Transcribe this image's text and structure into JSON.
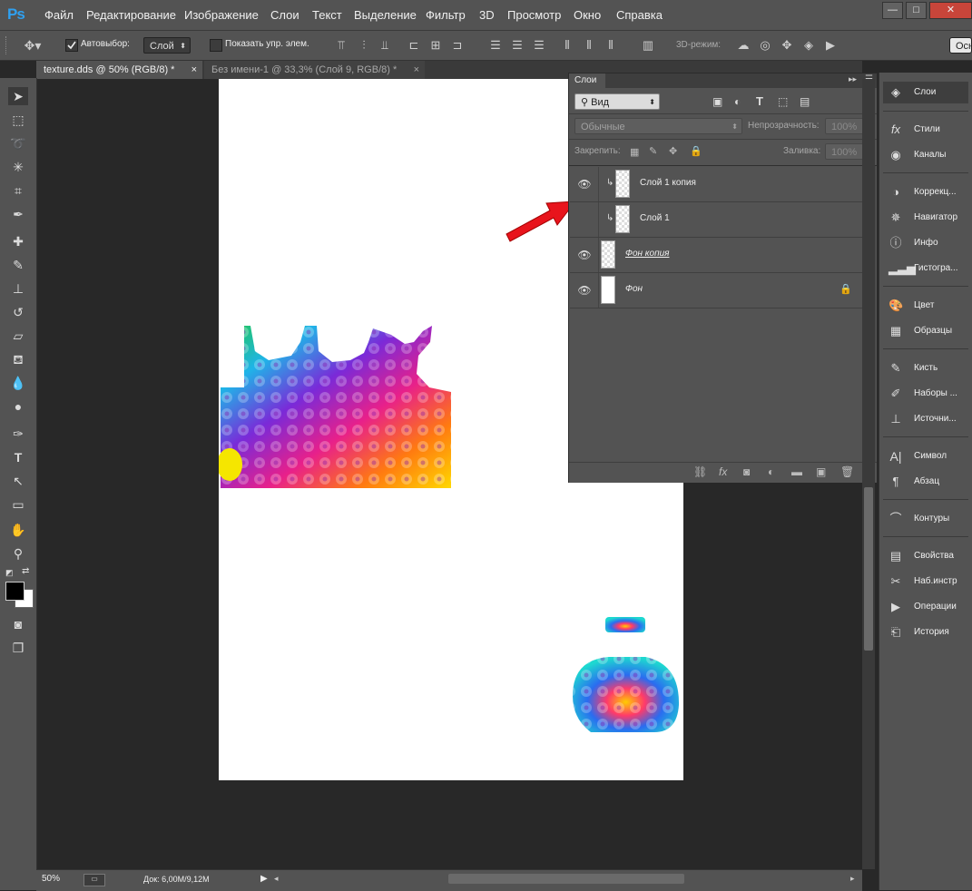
{
  "app": {
    "logo": "Ps"
  },
  "menu": [
    "Файл",
    "Редактирование",
    "Изображение",
    "Слои",
    "Текст",
    "Выделение",
    "Фильтр",
    "3D",
    "Просмотр",
    "Окно",
    "Справка"
  ],
  "window_controls": {
    "minimize": "—",
    "maximize": "□",
    "close": "✕"
  },
  "options_bar": {
    "autoselect_label": "Автовыбор:",
    "autoselect_checked": true,
    "autoselect_target": "Слой",
    "show_transform_label": "Показать упр. элем.",
    "mode3d_label": "3D-режим:",
    "workspace_button": "Осн"
  },
  "tabs": [
    {
      "label": "texture.dds @ 50% (RGB/8) *",
      "close": "×",
      "active": true
    },
    {
      "label": "Без имени-1 @ 33,3% (Слой 9, RGB/8) *",
      "close": "×",
      "active": false
    }
  ],
  "layers_panel": {
    "title": "Слои",
    "filter_kind": "Вид",
    "blend_mode": "Обычные",
    "opacity_label": "Непрозрачность:",
    "opacity_value": "100%",
    "lock_label": "Закрепить:",
    "fill_label": "Заливка:",
    "fill_value": "100%",
    "layers": [
      {
        "name": "Слой 1 копия",
        "clipped": true,
        "visible": true,
        "locked": false
      },
      {
        "name": "Слой 1",
        "clipped": true,
        "visible": true,
        "locked": false
      },
      {
        "name": "Фон копия",
        "clipped": false,
        "visible": true,
        "locked": false
      },
      {
        "name": "Фон",
        "clipped": false,
        "visible": true,
        "locked": true
      }
    ]
  },
  "dock": [
    {
      "label": "Слои",
      "icon": "layers-icon",
      "active": true
    },
    {
      "label": "Стили",
      "icon": "styles-icon"
    },
    {
      "label": "Каналы",
      "icon": "channels-icon"
    },
    {
      "label": "Коррекц...",
      "icon": "adjustments-icon"
    },
    {
      "label": "Навигатор",
      "icon": "navigator-icon"
    },
    {
      "label": "Инфо",
      "icon": "info-icon"
    },
    {
      "label": "Гистогра...",
      "icon": "histogram-icon"
    },
    {
      "label": "Цвет",
      "icon": "color-icon"
    },
    {
      "label": "Образцы",
      "icon": "swatches-icon"
    },
    {
      "label": "Кисть",
      "icon": "brush-icon"
    },
    {
      "label": "Наборы ...",
      "icon": "brush-presets-icon"
    },
    {
      "label": "Источни...",
      "icon": "clone-source-icon"
    },
    {
      "label": "Символ",
      "icon": "character-icon"
    },
    {
      "label": "Абзац",
      "icon": "paragraph-icon"
    },
    {
      "label": "Контуры",
      "icon": "paths-icon"
    },
    {
      "label": "Свойства",
      "icon": "properties-icon"
    },
    {
      "label": "Наб.инстр",
      "icon": "tool-presets-icon"
    },
    {
      "label": "Операции",
      "icon": "actions-icon"
    },
    {
      "label": "История",
      "icon": "history-icon"
    }
  ],
  "status": {
    "zoom": "50%",
    "doc_info": "Док: 6,00M/9,12M"
  }
}
